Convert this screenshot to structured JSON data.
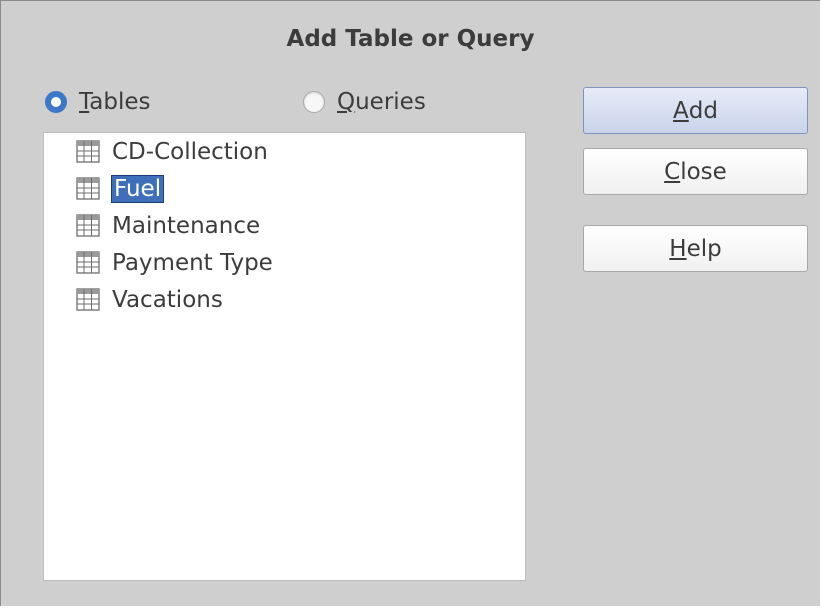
{
  "dialog": {
    "title": "Add Table or Query"
  },
  "radios": {
    "tables": {
      "first": "T",
      "rest": "ables",
      "checked": true
    },
    "queries": {
      "first": "Q",
      "rest": "ueries",
      "checked": false
    }
  },
  "list": {
    "items": [
      {
        "label": "CD-Collection",
        "selected": false
      },
      {
        "label": "Fuel",
        "selected": true
      },
      {
        "label": "Maintenance",
        "selected": false
      },
      {
        "label": "Payment Type",
        "selected": false
      },
      {
        "label": "Vacations",
        "selected": false
      }
    ],
    "icon": "table-icon"
  },
  "buttons": {
    "add": {
      "first": "A",
      "rest": "dd"
    },
    "close": {
      "first": "C",
      "rest": "lose"
    },
    "help": {
      "first": "H",
      "rest": "elp"
    }
  },
  "colors": {
    "accent": "#3e6fb8",
    "radio_checked": "#3c78c8",
    "dialog_bg": "#cfcfcf"
  }
}
